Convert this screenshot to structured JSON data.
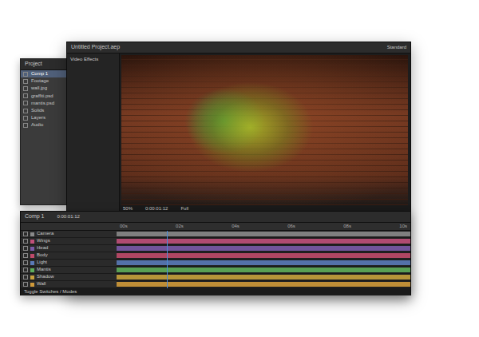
{
  "window": {
    "title": "Untitled Project.aep",
    "workspace": "Standard"
  },
  "left_panel": {
    "title": "Video Effects"
  },
  "project": {
    "title": "Project",
    "items": [
      {
        "label": "Comp 1",
        "selected": true
      },
      {
        "label": "Footage",
        "selected": false
      },
      {
        "label": "wall.jpg",
        "selected": false
      },
      {
        "label": "graffiti.psd",
        "selected": false
      },
      {
        "label": "mantis.psd",
        "selected": false
      },
      {
        "label": "Solids",
        "selected": false
      },
      {
        "label": "Layers",
        "selected": false
      },
      {
        "label": "Audio",
        "selected": false
      }
    ]
  },
  "viewer": {
    "zoom": "50%",
    "timecode": "0:00:01:12",
    "quality": "Full"
  },
  "timeline": {
    "tab": "Comp 1",
    "timecode": "0:00:01:12",
    "ticks": [
      "00s",
      "02s",
      "04s",
      "06s",
      "08s",
      "10s"
    ],
    "playhead": {
      "level": 0.17
    },
    "layers": [
      {
        "name": "Camera",
        "color": "#8a8a8a"
      },
      {
        "name": "Wings",
        "color": "#c0507a"
      },
      {
        "name": "Head",
        "color": "#7a5aa8"
      },
      {
        "name": "Body",
        "color": "#c04a6a"
      },
      {
        "name": "Light",
        "color": "#5a7ab8"
      },
      {
        "name": "Mantis",
        "color": "#5fae5a"
      },
      {
        "name": "Shadow",
        "color": "#c8a23c"
      },
      {
        "name": "Wall",
        "color": "#d09a3a"
      }
    ],
    "footer": "Toggle Switches / Modes"
  }
}
